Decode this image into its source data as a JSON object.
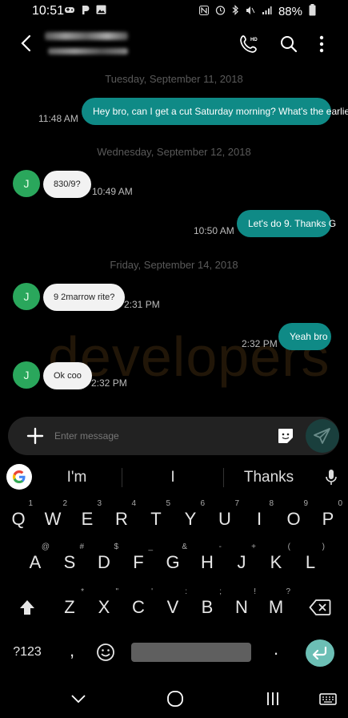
{
  "status_bar": {
    "time": "10:51",
    "left_icons": [
      "game-icon",
      "pandora-icon",
      "gallery-icon"
    ],
    "right_icons": [
      "nfc-icon",
      "alarm-icon",
      "bluetooth-icon",
      "mute-icon",
      "signal-icon"
    ],
    "battery": "88%"
  },
  "chat": {
    "date_1": "Tuesday, September 11, 2018",
    "msg_1": "Hey bro, can I get a cut Saturday morning? What's the earliest?",
    "time_1": "11:48 AM",
    "date_2": "Wednesday, September 12, 2018",
    "msg_2": "830/9?",
    "time_2": "10:49 AM",
    "msg_3": "Let's do 9. Thanks G",
    "time_3": "10:50 AM",
    "date_3": "Friday, September 14, 2018",
    "msg_4": "9 2marrow rite?",
    "time_4": "2:31 PM",
    "msg_5": "Yeah bro",
    "time_5": "2:32 PM",
    "msg_6": "Ok coo",
    "time_6": "2:32 PM",
    "avatar_initial": "J"
  },
  "watermark": "developers",
  "composer": {
    "placeholder": "Enter message"
  },
  "keyboard": {
    "suggestions": [
      "I'm",
      "I",
      "Thanks"
    ],
    "row1": [
      [
        "Q",
        "1"
      ],
      [
        "W",
        "2"
      ],
      [
        "E",
        "3"
      ],
      [
        "R",
        "4"
      ],
      [
        "T",
        "5"
      ],
      [
        "Y",
        "6"
      ],
      [
        "U",
        "7"
      ],
      [
        "I",
        "8"
      ],
      [
        "O",
        "9"
      ],
      [
        "P",
        "0"
      ]
    ],
    "row2": [
      [
        "A",
        "@"
      ],
      [
        "S",
        "#"
      ],
      [
        "D",
        "$"
      ],
      [
        "F",
        "_"
      ],
      [
        "G",
        "&"
      ],
      [
        "H",
        "-"
      ],
      [
        "J",
        "+"
      ],
      [
        "K",
        "("
      ],
      [
        "L",
        ")"
      ]
    ],
    "row3": [
      [
        "Z",
        "*"
      ],
      [
        "X",
        "\""
      ],
      [
        "C",
        "'"
      ],
      [
        "V",
        ":"
      ],
      [
        "B",
        ";"
      ],
      [
        "N",
        "!"
      ],
      [
        "M",
        "?"
      ]
    ],
    "symbols_key": "?123",
    "comma": ",",
    "period": "."
  },
  "colors": {
    "outgoing_bubble": "#0f8a86",
    "incoming_bubble": "#f2f2f2",
    "avatar": "#2aa75c",
    "enter_key": "#6cbfb5"
  }
}
